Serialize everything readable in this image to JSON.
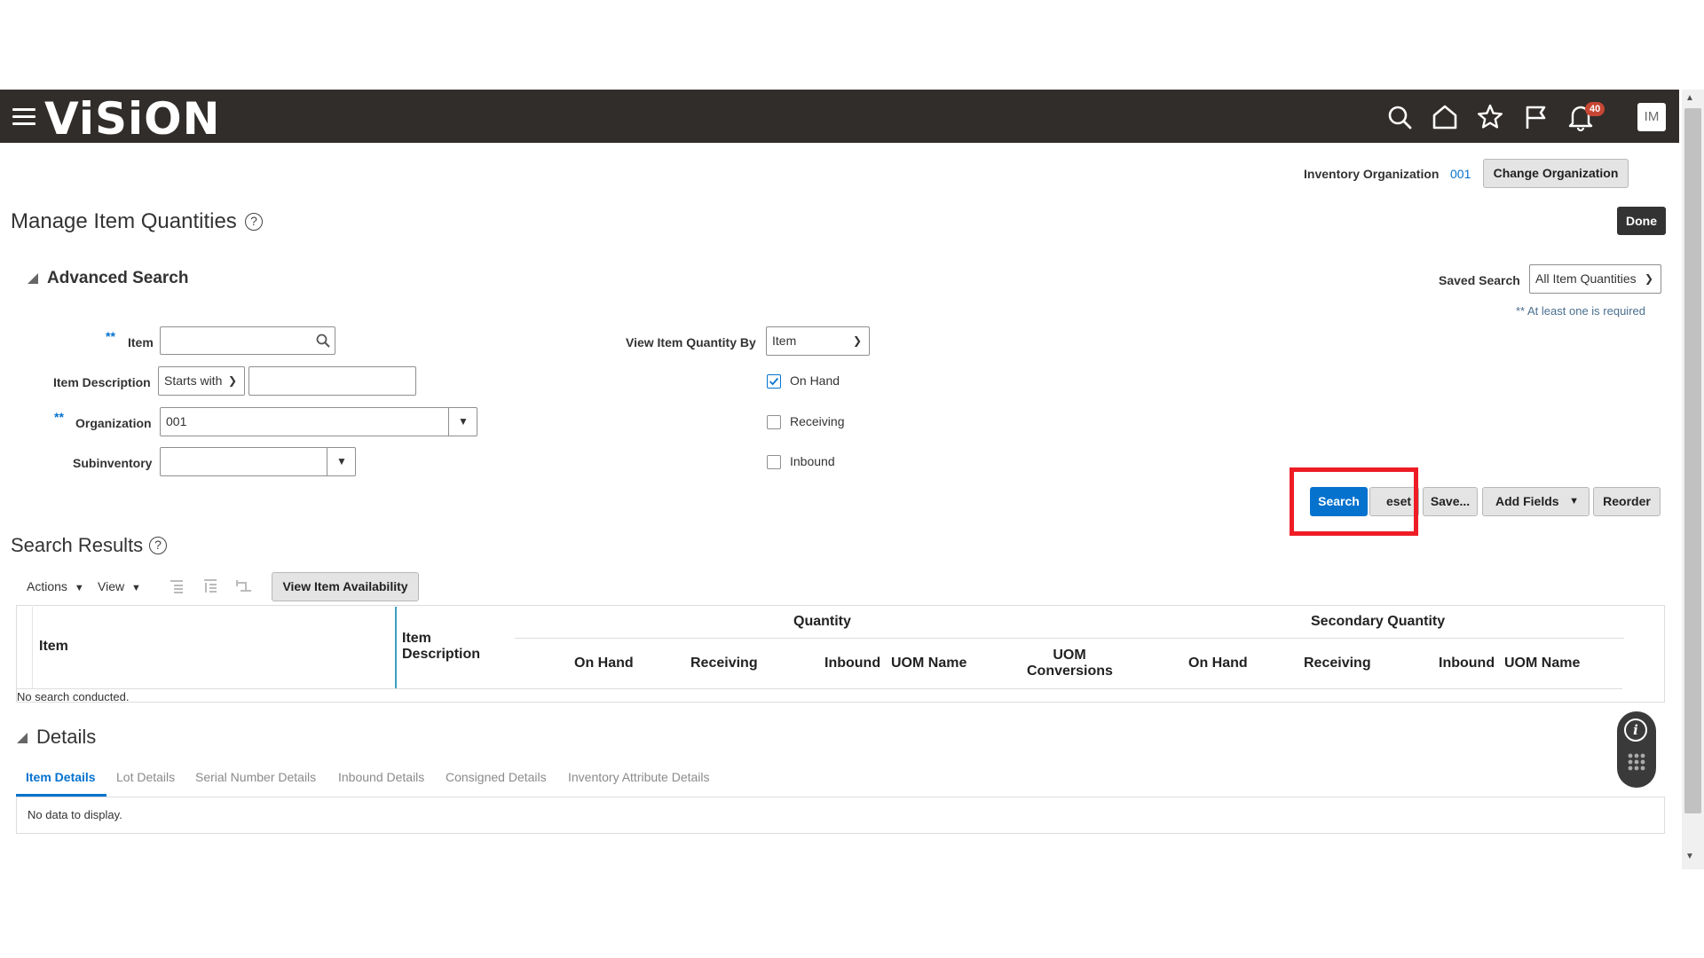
{
  "header": {
    "logo": "ViSiON",
    "notification_count": "40",
    "avatar_initials": "IM",
    "bg_color": "#312d2a"
  },
  "org_bar": {
    "label": "Inventory Organization",
    "value": "001",
    "change_button": "Change Organization"
  },
  "page": {
    "title": "Manage Item Quantities",
    "done_button": "Done"
  },
  "advanced_search": {
    "title": "Advanced Search",
    "saved_search_label": "Saved Search",
    "saved_search_value": "All Item Quantities",
    "required_note": "** At least one is required",
    "required_marker": "**",
    "fields": {
      "item_label": "Item",
      "item_description_label": "Item Description",
      "item_description_operator": "Starts with",
      "organization_label": "Organization",
      "organization_value": "001",
      "subinventory_label": "Subinventory",
      "view_by_label": "View Item Quantity By",
      "view_by_value": "Item"
    },
    "checkboxes": {
      "on_hand": "On Hand",
      "receiving": "Receiving",
      "inbound": "Inbound"
    },
    "buttons": {
      "search": "Search",
      "reset": "eset",
      "save": "Save...",
      "add_fields": "Add Fields",
      "reorder": "Reorder"
    }
  },
  "search_results": {
    "title": "Search Results",
    "actions_menu": "Actions",
    "view_menu": "View",
    "view_availability_button": "View Item Availability",
    "columns": {
      "item": "Item",
      "item_description_line1": "Item",
      "item_description_line2": "Description",
      "quantity_group": "Quantity",
      "secondary_group": "Secondary Quantity",
      "on_hand": "On Hand",
      "receiving": "Receiving",
      "inbound": "Inbound",
      "uom_name": "UOM Name",
      "uom_conv_line1": "UOM",
      "uom_conv_line2": "Conversions",
      "sec_on_hand": "On Hand",
      "sec_receiving": "Receiving",
      "sec_inbound": "Inbound",
      "sec_uom_name": "UOM Name"
    },
    "empty_message": "No search conducted."
  },
  "details": {
    "title": "Details",
    "tabs": [
      "Item Details",
      "Lot Details",
      "Serial Number Details",
      "Inbound Details",
      "Consigned Details",
      "Inventory Attribute Details"
    ],
    "empty_message": "No data to display."
  },
  "colors": {
    "accent": "#0572ce",
    "highlight_box": "#ee1c25"
  }
}
